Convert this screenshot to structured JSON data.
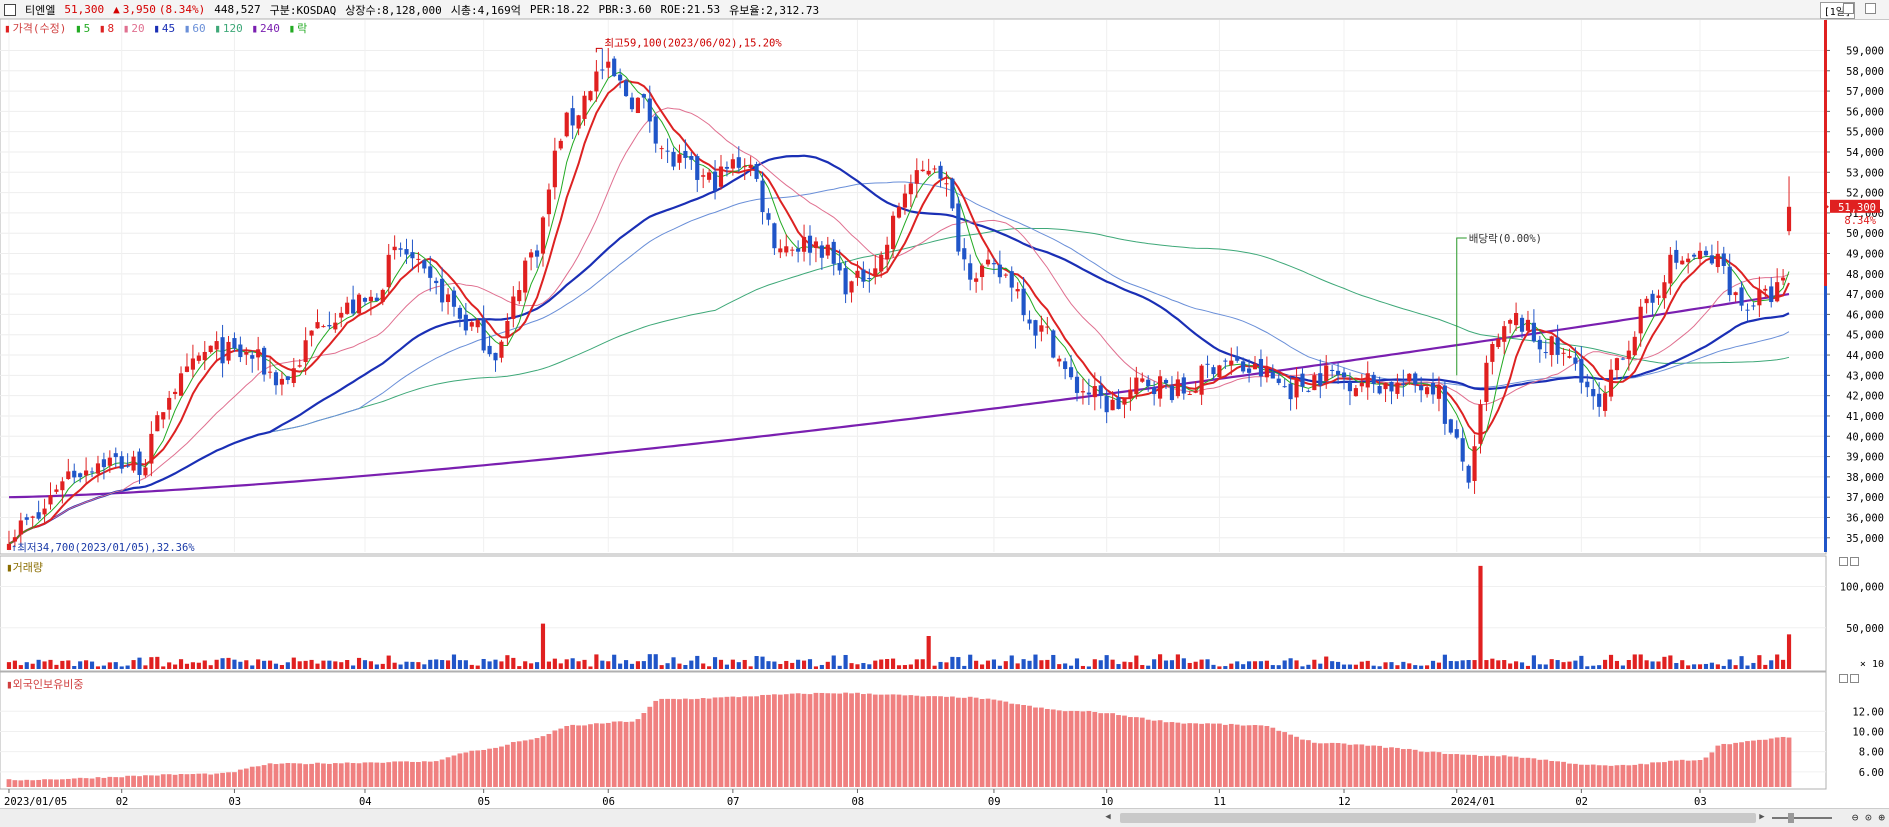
{
  "header": {
    "stock_name": "티엔엘",
    "price": "51,300",
    "change_arrow": "▲",
    "change": "3,950",
    "change_pct": "(8.34%)",
    "volume": "448,527",
    "market": "구분:KOSDAQ",
    "shares": "상장수:8,128,000",
    "market_cap": "시총:4,169억",
    "per": "PER:18.22",
    "pbr": "PBR:3.60",
    "roe": "ROE:21.53",
    "float": "유보율:2,312.73",
    "period": "[1일]"
  },
  "legend": {
    "price_label": "가격(수정)",
    "ma": [
      {
        "label": "5",
        "color": "#22aa22"
      },
      {
        "label": "8",
        "color": "#dd2222"
      },
      {
        "label": "20",
        "color": "#e07090"
      },
      {
        "label": "45",
        "color": "#1a2fb5"
      },
      {
        "label": "60",
        "color": "#6a8fd8"
      },
      {
        "label": "120",
        "color": "#3ea878"
      },
      {
        "label": "240",
        "color": "#7a1fb0"
      }
    ],
    "ex_label": "락"
  },
  "annotations": {
    "high": "최고59,100(2023/06/02),15.20%",
    "low": "최저34,700(2023/01/05),32.36%",
    "dividend": "배당락(0.00%)",
    "last_price": "51,300",
    "last_pct": "8.34%"
  },
  "panes": {
    "volume_label": "거래량",
    "volume_unit": "× 10",
    "foreign_label": "외국인보유비중"
  },
  "colors": {
    "up": "#e02020",
    "down": "#2055c8",
    "volume_up": "#e02020",
    "volume_down": "#2055c8",
    "foreign": "#f08080"
  },
  "chart_data": {
    "type": "candlestick",
    "price_axis": {
      "ticks": [
        "35,000",
        "36,000",
        "37,000",
        "38,000",
        "39,000",
        "40,000",
        "41,000",
        "42,000",
        "43,000",
        "44,000",
        "45,000",
        "46,000",
        "47,000",
        "48,000",
        "49,000",
        "50,000",
        "51,000",
        "52,000",
        "53,000",
        "54,000",
        "55,000",
        "56,000",
        "57,000",
        "58,000",
        "59,000"
      ],
      "ylim": [
        34300,
        60500
      ]
    },
    "volume_axis": {
      "ticks": [
        "50,000",
        "100,000"
      ],
      "ylim": [
        0,
        120000
      ]
    },
    "foreign_axis": {
      "ticks": [
        "6.00",
        "8.00",
        "10.00",
        "12.00"
      ],
      "ylim": [
        4.5,
        14.5
      ]
    },
    "x_labels": [
      "2023/01/05",
      "02",
      "03",
      "04",
      "05",
      "06",
      "07",
      "08",
      "09",
      "10",
      "11",
      "12",
      "2024/01",
      "02",
      "03"
    ],
    "close_anchors": [
      {
        "t": 0,
        "v": 35300
      },
      {
        "t": 4,
        "v": 35800
      },
      {
        "t": 10,
        "v": 38200
      },
      {
        "t": 16,
        "v": 38800
      },
      {
        "t": 22,
        "v": 38600
      },
      {
        "t": 28,
        "v": 42500
      },
      {
        "t": 34,
        "v": 44200
      },
      {
        "t": 40,
        "v": 44000
      },
      {
        "t": 46,
        "v": 42800
      },
      {
        "t": 54,
        "v": 46000
      },
      {
        "t": 60,
        "v": 46500
      },
      {
        "t": 66,
        "v": 49100
      },
      {
        "t": 72,
        "v": 47200
      },
      {
        "t": 78,
        "v": 45400
      },
      {
        "t": 82,
        "v": 44200
      },
      {
        "t": 88,
        "v": 48900
      },
      {
        "t": 94,
        "v": 55400
      },
      {
        "t": 100,
        "v": 58000
      },
      {
        "t": 106,
        "v": 56500
      },
      {
        "t": 112,
        "v": 53500
      },
      {
        "t": 118,
        "v": 52600
      },
      {
        "t": 124,
        "v": 53600
      },
      {
        "t": 130,
        "v": 49400
      },
      {
        "t": 136,
        "v": 49500
      },
      {
        "t": 142,
        "v": 47400
      },
      {
        "t": 146,
        "v": 48500
      },
      {
        "t": 152,
        "v": 52400
      },
      {
        "t": 156,
        "v": 53500
      },
      {
        "t": 162,
        "v": 48300
      },
      {
        "t": 168,
        "v": 47900
      },
      {
        "t": 174,
        "v": 45200
      },
      {
        "t": 180,
        "v": 42400
      },
      {
        "t": 186,
        "v": 41500
      },
      {
        "t": 192,
        "v": 42700
      },
      {
        "t": 198,
        "v": 42200
      },
      {
        "t": 204,
        "v": 43700
      },
      {
        "t": 210,
        "v": 43200
      },
      {
        "t": 216,
        "v": 42400
      },
      {
        "t": 222,
        "v": 43100
      },
      {
        "t": 228,
        "v": 42700
      },
      {
        "t": 234,
        "v": 42500
      },
      {
        "t": 240,
        "v": 42600
      },
      {
        "t": 244,
        "v": 39500
      },
      {
        "t": 246,
        "v": 38000
      },
      {
        "t": 250,
        "v": 44300
      },
      {
        "t": 254,
        "v": 45700
      },
      {
        "t": 258,
        "v": 44600
      },
      {
        "t": 264,
        "v": 43600
      },
      {
        "t": 268,
        "v": 41200
      },
      {
        "t": 272,
        "v": 44300
      },
      {
        "t": 276,
        "v": 46200
      },
      {
        "t": 280,
        "v": 48500
      },
      {
        "t": 284,
        "v": 48800
      },
      {
        "t": 288,
        "v": 48600
      },
      {
        "t": 292,
        "v": 46500
      },
      {
        "t": 296,
        "v": 46800
      },
      {
        "t": 299,
        "v": 47400
      },
      {
        "t": 300,
        "v": 51300
      }
    ],
    "ma_endpoints": {
      "ma5": 47500,
      "ma8": 47200,
      "ma20": 47000,
      "ma45": 45700,
      "ma60": 45000,
      "ma120": 43800,
      "ma240": 47000
    },
    "volume_spikes": [
      {
        "t": 90,
        "v": 55000
      },
      {
        "t": 155,
        "v": 40000
      },
      {
        "t": 248,
        "v": 125000
      },
      {
        "t": 300,
        "v": 42000
      }
    ],
    "foreign_anchors": [
      {
        "t": 0,
        "v": 5.2
      },
      {
        "t": 35,
        "v": 5.8
      },
      {
        "t": 45,
        "v": 6.8
      },
      {
        "t": 70,
        "v": 7.0
      },
      {
        "t": 80,
        "v": 8.2
      },
      {
        "t": 88,
        "v": 9.2
      },
      {
        "t": 95,
        "v": 10.6
      },
      {
        "t": 105,
        "v": 11.0
      },
      {
        "t": 110,
        "v": 13.2
      },
      {
        "t": 140,
        "v": 13.8
      },
      {
        "t": 160,
        "v": 13.4
      },
      {
        "t": 180,
        "v": 12.0
      },
      {
        "t": 200,
        "v": 10.8
      },
      {
        "t": 210,
        "v": 10.6
      },
      {
        "t": 222,
        "v": 8.8
      },
      {
        "t": 250,
        "v": 7.6
      },
      {
        "t": 270,
        "v": 6.6
      },
      {
        "t": 285,
        "v": 7.2
      },
      {
        "t": 289,
        "v": 8.8
      },
      {
        "t": 300,
        "v": 9.4
      }
    ]
  }
}
